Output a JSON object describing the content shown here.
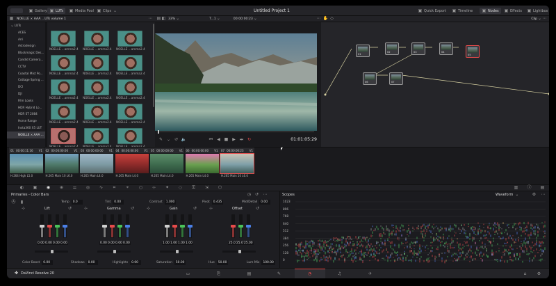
{
  "topbar": {
    "title": "Untitled Project 1",
    "left_tabs": [
      {
        "label": "Gallery",
        "icon": "gallery-icon"
      },
      {
        "label": "LUTs",
        "icon": "luts-icon",
        "active": true
      },
      {
        "label": "Media Pool",
        "icon": "media-pool-icon"
      },
      {
        "label": "Clips",
        "icon": "clips-icon",
        "dropdown": true
      }
    ],
    "right_tabs": [
      {
        "label": "Quick Export",
        "icon": "export-icon"
      },
      {
        "label": "Timeline",
        "icon": "timeline-icon"
      },
      {
        "label": "Nodes",
        "icon": "nodes-icon",
        "active": true
      },
      {
        "label": "Effects",
        "icon": "effects-icon"
      },
      {
        "label": "Lightbox",
        "icon": "lightbox-icon"
      }
    ]
  },
  "lut_panel": {
    "header": "NOELLE × AAA ...UTs volume 1",
    "tree_root": "LUTs",
    "items": [
      "ACES",
      "Arri",
      "Astrodesign",
      "Blackmagic Des...",
      "Candid Camera...",
      "CCTV",
      "Coastal Mist Po...",
      "Cottage Spring ...",
      "DCI",
      "DJI",
      "Film Looks",
      "HDR Hybrid Lo...",
      "HDR ST 2084",
      "Horse Range",
      "Insta360 X5 LUT",
      "NOELLE × AAA ..."
    ],
    "selected_index": 15,
    "thumbs": [
      {
        "label": "NOELLE ...amma2.4"
      },
      {
        "label": "NOELLE ...amma2.4"
      },
      {
        "label": "NOELLE ...amma2.4"
      },
      {
        "label": "NOELLE ...amma2.4"
      },
      {
        "label": "NOELLE ...amma2.4"
      },
      {
        "label": "NOELLE ...amma2.4"
      },
      {
        "label": "NOELLE ...amma2.4"
      },
      {
        "label": "NOELLE ...amma2.4"
      },
      {
        "label": "NOELLE ...amma2.4"
      },
      {
        "label": "NOELLE ...amma2.4"
      },
      {
        "label": "NOELLE ...amma2.4"
      },
      {
        "label": "NOELLE ...amma2.4"
      },
      {
        "label": "NOELLE ...amma2.4",
        "red": true
      },
      {
        "label": "NOELLE ...amma2.4"
      },
      {
        "label": "NOELLE ...amma2.4"
      }
    ]
  },
  "viewer": {
    "zoom": "33%",
    "clip_name": "T...1",
    "source_timecode": "00:00:00:23",
    "timecode": "01:01:05:29"
  },
  "nodes": {
    "mode": "Clip",
    "items": [
      {
        "label": "01"
      },
      {
        "label": "02"
      },
      {
        "label": "03"
      },
      {
        "label": "04"
      },
      {
        "label": "05"
      },
      {
        "label": "06"
      },
      {
        "label": "07"
      }
    ]
  },
  "clips": [
    {
      "num": "01",
      "tc": "00:00:11:16",
      "track": "V1",
      "codec": "H.264 High L5.0",
      "colors": [
        "#5a8fb2",
        "#7fa6a8",
        "#3d5b48"
      ]
    },
    {
      "num": "02",
      "tc": "00:00:00:00",
      "track": "V1",
      "codec": "H.265 Main 10 L6.0",
      "colors": [
        "#77a2c2",
        "#4f7a6a",
        "#2f4a3c"
      ]
    },
    {
      "num": "03",
      "tc": "00:00:00:00",
      "track": "V1",
      "codec": "H.265 Main L4.0",
      "colors": [
        "#9fb6c8",
        "#7d9aa3",
        "#5a6b6d"
      ]
    },
    {
      "num": "04",
      "tc": "00:00:00:00",
      "track": "V1",
      "codec": "H.265 Main L4.0",
      "colors": [
        "#c9413c",
        "#8e2b2a",
        "#5a1d1d"
      ]
    },
    {
      "num": "05",
      "tc": "00:00:00:00",
      "track": "V1",
      "codec": "H.265 Main L4.0",
      "colors": [
        "#5c8e6a",
        "#3e6b4e",
        "#2b4b38"
      ]
    },
    {
      "num": "06",
      "tc": "00:00:00:00",
      "track": "V1",
      "codec": "H.265 Main L4.0",
      "colors": [
        "#e07ab0",
        "#6aa050",
        "#3b6b30"
      ]
    },
    {
      "num": "07",
      "tc": "00:00:00:23",
      "track": "V1",
      "codec": "H.265 Main 10 L6.0",
      "colors": [
        "#c9c4b6",
        "#7fa0a8",
        "#3d5b58"
      ],
      "selected": true
    }
  ],
  "primaries": {
    "title": "Primaries - Color Bars",
    "temp": {
      "label": "Temp",
      "value": "0.0"
    },
    "tint": {
      "label": "Tint",
      "value": "0.00"
    },
    "contrast": {
      "label": "Contrast",
      "value": "1.000"
    },
    "pivot": {
      "label": "Pivot",
      "value": "0.435"
    },
    "middetail": {
      "label": "Mid/Detail",
      "value": "0.00"
    },
    "wheels": [
      {
        "name": "Lift",
        "values": [
          "0.00",
          "0.00",
          "0.00",
          "0.00"
        ],
        "levels": [
          0.5,
          0.5,
          0.5,
          0.5
        ]
      },
      {
        "name": "Gamma",
        "values": [
          "0.00",
          "0.00",
          "0.00",
          "0.00"
        ],
        "levels": [
          0.5,
          0.5,
          0.5,
          0.5
        ]
      },
      {
        "name": "Gain",
        "values": [
          "1.00",
          "1.00",
          "1.00",
          "1.00"
        ],
        "levels": [
          0.5,
          0.5,
          0.5,
          0.5
        ]
      },
      {
        "name": "Offset",
        "values": [
          "25.00",
          "25.00",
          "25.00"
        ],
        "levels": [
          0.5,
          0.5,
          0.5
        ]
      }
    ],
    "colorboost": {
      "label": "Color Boost",
      "value": "0.00"
    },
    "shadows": {
      "label": "Shadows",
      "value": "0.00"
    },
    "highlights": {
      "label": "Highlights",
      "value": "0.00"
    },
    "saturation": {
      "label": "Saturation",
      "value": "50.00"
    },
    "hue": {
      "label": "Hue",
      "value": "50.00"
    },
    "lummix": {
      "label": "Lum Mix",
      "value": "100.00"
    }
  },
  "scopes": {
    "title": "Scopes",
    "mode": "Waveform",
    "ticks": [
      "1023",
      "896",
      "768",
      "640",
      "512",
      "384",
      "256",
      "128",
      "0"
    ]
  },
  "bottombar": {
    "app": "DaVinci Resolve 20"
  },
  "colors": {
    "accent": "#e64b4b",
    "node_link": "#d9d3a3"
  }
}
